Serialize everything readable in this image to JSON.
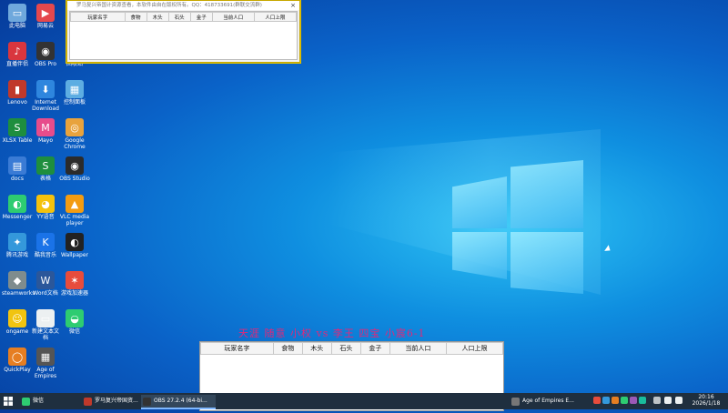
{
  "desktop": {
    "icons": [
      {
        "label": "此电脑",
        "color": "#6fa8dc",
        "glyph": "▭"
      },
      {
        "label": "网易云",
        "color": "#e5484d",
        "glyph": "▶"
      },
      {
        "label": "网络",
        "color": "#4a90d9",
        "glyph": "◍"
      },
      {
        "label": "直播伴侣",
        "color": "#d9363e",
        "glyph": "♪"
      },
      {
        "label": "OBS Pro",
        "color": "#333",
        "glyph": "◉"
      },
      {
        "label": "回收站",
        "color": "#8fb3d9",
        "glyph": "▯"
      },
      {
        "label": "Lenovo",
        "color": "#c0392b",
        "glyph": "▮"
      },
      {
        "label": "Internet Download",
        "color": "#2e86de",
        "glyph": "⬇"
      },
      {
        "label": "控制面板",
        "color": "#5dade2",
        "glyph": "▦"
      },
      {
        "label": "XLSX Table",
        "color": "#1e8e3e",
        "glyph": "S"
      },
      {
        "label": "Mayo",
        "color": "#e74c8b",
        "glyph": "M"
      },
      {
        "label": "Google Chrome",
        "color": "#e8a33d",
        "glyph": "◎"
      },
      {
        "label": "docs",
        "color": "#3a7bd5",
        "glyph": "▤"
      },
      {
        "label": "表格",
        "color": "#1e8e3e",
        "glyph": "S"
      },
      {
        "label": "OBS Studio",
        "color": "#2b2b2b",
        "glyph": "◉"
      },
      {
        "label": "Messenger",
        "color": "#2ecc71",
        "glyph": "◐"
      },
      {
        "label": "YY语音",
        "color": "#f4c20d",
        "glyph": "◕"
      },
      {
        "label": "VLC media player",
        "color": "#f39c12",
        "glyph": "▲"
      },
      {
        "label": "腾讯游戏",
        "color": "#3498db",
        "glyph": "✦"
      },
      {
        "label": "酷我音乐",
        "color": "#1a73e8",
        "glyph": "K"
      },
      {
        "label": "Wallpaper",
        "color": "#222",
        "glyph": "◐"
      },
      {
        "label": "steamworks",
        "color": "#7f8c8d",
        "glyph": "◆"
      },
      {
        "label": "Word文档",
        "color": "#2b579a",
        "glyph": "W"
      },
      {
        "label": "游戏加速器",
        "color": "#e74c3c",
        "glyph": "✶"
      },
      {
        "label": "ongame",
        "color": "#f1c40f",
        "glyph": "☺"
      },
      {
        "label": "新建文本文档",
        "color": "#ecf0f1",
        "glyph": "▭"
      },
      {
        "label": "微信",
        "color": "#2ecc71",
        "glyph": "◒"
      },
      {
        "label": "QuickPlay",
        "color": "#e67e22",
        "glyph": "◯"
      },
      {
        "label": "Age of Empires",
        "color": "#555",
        "glyph": "▦"
      }
    ]
  },
  "window_top": {
    "title": "罗马复兴帝国计资源查看，本软件由自在版权所有。QQ：418733691(群联交流群)",
    "close": "×",
    "columns": [
      "玩家名字",
      "食物",
      "木头",
      "石头",
      "金子",
      "当前人口",
      "人口上限"
    ]
  },
  "window_bottom": {
    "banner": "天涯 随意 小权 vs 李王 四宝 小宸6-1",
    "columns": [
      "玩家名字",
      "食物",
      "木头",
      "石头",
      "金子",
      "当前人口",
      "人口上限"
    ]
  },
  "taskbar": {
    "items": [
      {
        "label": "微信",
        "color": "#2ecc71"
      },
      {
        "label": "罗马复兴帝国资...",
        "color": "#c0392b"
      },
      {
        "label": "OBS 27.2.4 (64-bi...",
        "color": "#333"
      },
      {
        "label": "Age of Empires E...",
        "color": "#777"
      }
    ],
    "time": "20:16",
    "date": "2026/1/18"
  }
}
